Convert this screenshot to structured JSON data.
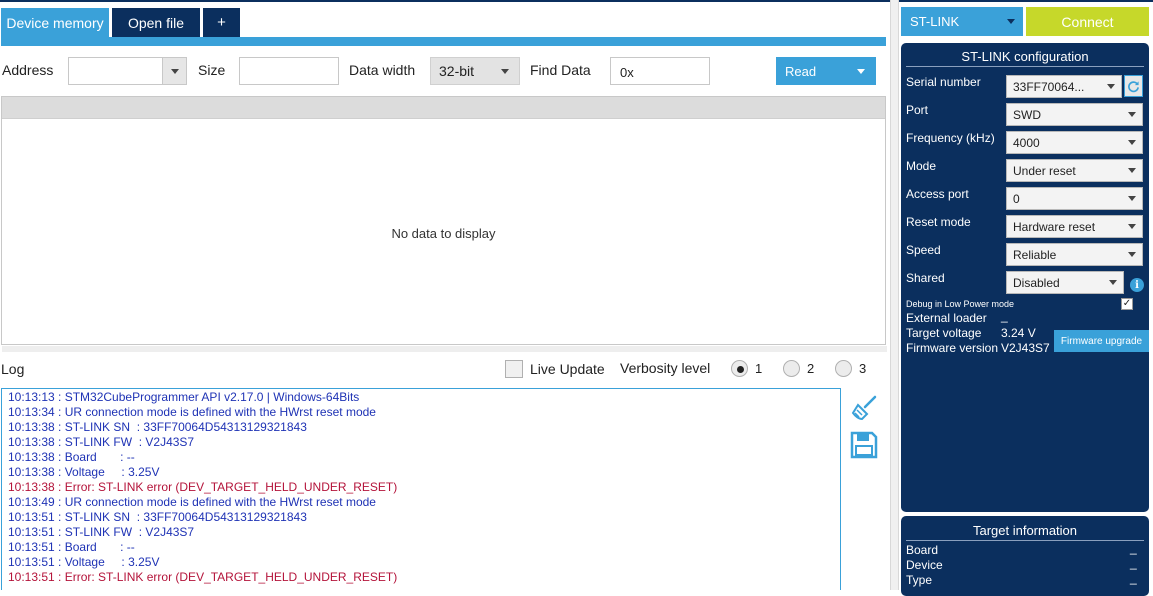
{
  "tabs": [
    {
      "label": "Device memory"
    },
    {
      "label": "Open file"
    },
    {
      "label": "+"
    }
  ],
  "toolbar": {
    "address_label": "Address",
    "address_value": "",
    "size_label": "Size",
    "size_value": "",
    "data_width_label": "Data width",
    "data_width_value": "32-bit",
    "find_data_label": "Find Data",
    "find_data_value": "0x",
    "read_label": "Read"
  },
  "memory": {
    "empty_text": "No data to display"
  },
  "log": {
    "title": "Log",
    "live_update_label": "Live Update",
    "verbosity_label": "Verbosity level",
    "verbosity_options": [
      "1",
      "2",
      "3"
    ],
    "verbosity_selected": "1",
    "lines": [
      {
        "text": "10:13:13 : STM32CubeProgrammer API v2.17.0 | Windows-64Bits",
        "level": "info"
      },
      {
        "text": "10:13:34 : UR connection mode is defined with the HWrst reset mode",
        "level": "info"
      },
      {
        "text": "10:13:38 : ST-LINK SN  : 33FF70064D54313129321843",
        "level": "info"
      },
      {
        "text": "10:13:38 : ST-LINK FW  : V2J43S7",
        "level": "info"
      },
      {
        "text": "10:13:38 : Board       : --",
        "level": "info"
      },
      {
        "text": "10:13:38 : Voltage     : 3.25V",
        "level": "info"
      },
      {
        "text": "10:13:38 : Error: ST-LINK error (DEV_TARGET_HELD_UNDER_RESET)",
        "level": "error"
      },
      {
        "text": "10:13:49 : UR connection mode is defined with the HWrst reset mode",
        "level": "info"
      },
      {
        "text": "10:13:51 : ST-LINK SN  : 33FF70064D54313129321843",
        "level": "info"
      },
      {
        "text": "10:13:51 : ST-LINK FW  : V2J43S7",
        "level": "info"
      },
      {
        "text": "10:13:51 : Board       : --",
        "level": "info"
      },
      {
        "text": "10:13:51 : Voltage     : 3.25V",
        "level": "info"
      },
      {
        "text": "10:13:51 : Error: ST-LINK error (DEV_TARGET_HELD_UNDER_RESET)",
        "level": "error"
      }
    ]
  },
  "connection": {
    "interface": "ST-LINK",
    "connect_label": "Connect"
  },
  "stlink_config": {
    "title": "ST-LINK configuration",
    "fields": [
      {
        "label": "Serial number",
        "value": "33FF70064..."
      },
      {
        "label": "Port",
        "value": "SWD"
      },
      {
        "label": "Frequency (kHz)",
        "value": "4000"
      },
      {
        "label": "Mode",
        "value": "Under reset"
      },
      {
        "label": "Access port",
        "value": "0"
      },
      {
        "label": "Reset mode",
        "value": "Hardware reset"
      },
      {
        "label": "Speed",
        "value": "Reliable"
      },
      {
        "label": "Shared",
        "value": "Disabled"
      }
    ],
    "debug_low_power_label": "Debug in Low Power mode",
    "debug_low_power_checked": true,
    "external_loader_label": "External loader",
    "external_loader_value": "_",
    "target_voltage_label": "Target voltage",
    "target_voltage_value": "3.24 V",
    "firmware_version_label": "Firmware version",
    "firmware_version_value": "V2J43S7",
    "firmware_upgrade_label": "Firmware upgrade"
  },
  "target_info": {
    "title": "Target information",
    "fields": [
      {
        "label": "Board",
        "value": "_"
      },
      {
        "label": "Device",
        "value": "_"
      },
      {
        "label": "Type",
        "value": "_"
      }
    ]
  },
  "colors": {
    "accent_blue": "#3aa1d9",
    "navy": "#0b2f5e",
    "connect_green": "#c6d82a",
    "log_info": "#1f33b5",
    "log_error": "#b4133a"
  },
  "icons": {
    "clear_log": "broom-icon",
    "save_log": "floppy-disk-icon",
    "refresh": "refresh-icon",
    "info": "info-icon"
  }
}
